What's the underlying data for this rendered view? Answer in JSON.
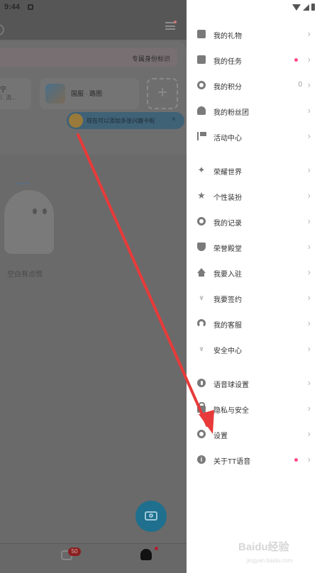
{
  "background": {
    "status_time": "9:44",
    "identity_tag": "专属身份标识",
    "tile1_title": "宁",
    "tile1_sub": "氵流...",
    "tile2_title": "国服 · 路图",
    "add_symbol": "+",
    "toast": "现在可以添加多张兴趣卡啦",
    "toast_close": "×",
    "empty_text": "空白有点慌",
    "chat_badge": "50"
  },
  "drawer": {
    "chevron": "›",
    "items": [
      {
        "label": "我的礼物",
        "icon": "gift-icon"
      },
      {
        "label": "我的任务",
        "icon": "task-icon",
        "dot": true
      },
      {
        "label": "我的积分",
        "icon": "points-icon",
        "count": "0"
      },
      {
        "label": "我的粉丝团",
        "icon": "fan-club-icon"
      },
      {
        "label": "活动中心",
        "icon": "flag-icon"
      },
      {
        "label": "荣耀世界",
        "icon": "glory-world-icon"
      },
      {
        "label": "个性装扮",
        "icon": "dress-up-icon"
      },
      {
        "label": "我的记录",
        "icon": "clock-icon"
      },
      {
        "label": "荣誉殿堂",
        "icon": "shield-icon"
      },
      {
        "label": "我要入驻",
        "icon": "house-icon"
      },
      {
        "label": "我要签约",
        "icon": "sprout-icon"
      },
      {
        "label": "我的客服",
        "icon": "headset-icon"
      },
      {
        "label": "安全中心",
        "icon": "security-icon"
      },
      {
        "label": "语音球设置",
        "icon": "mic-icon"
      },
      {
        "label": "隐私与安全",
        "icon": "lock-icon"
      },
      {
        "label": "设置",
        "icon": "gear-icon"
      },
      {
        "label": "关于TT语音",
        "icon": "info-icon",
        "dot": true
      }
    ]
  },
  "watermark": {
    "main": "Baidu经验",
    "sub": "jingyan.baidu.com"
  },
  "colors": {
    "drawer_bg": "#ffffff",
    "dot": "#ff4b8b",
    "arrow": "#e83a3a"
  }
}
